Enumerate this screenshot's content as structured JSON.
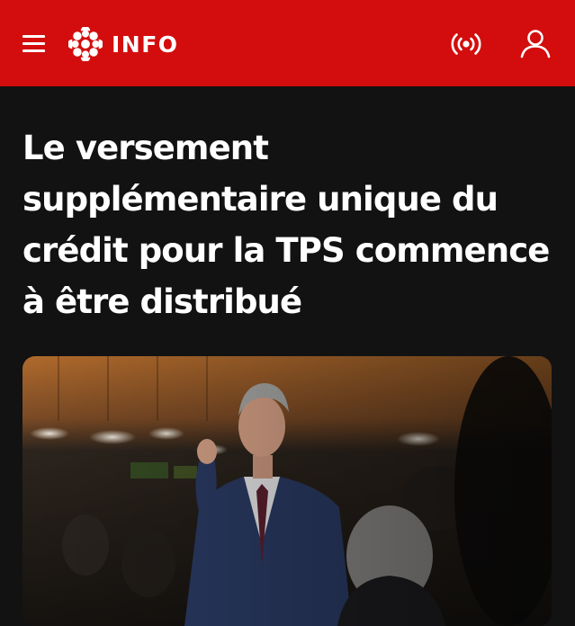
{
  "header": {
    "brand": "INFO",
    "background_color": "#d30d0d",
    "menu_icon": "hamburger-menu-icon",
    "logo_icon": "cbc-gem-icon",
    "live_icon": "live-broadcast-icon",
    "account_icon": "user-icon"
  },
  "article": {
    "headline": "Le versement supplémentaire unique du crédit pour la TPS commence à être distribué"
  },
  "colors": {
    "page_background": "#121212",
    "headline_text": "#ffffff"
  }
}
